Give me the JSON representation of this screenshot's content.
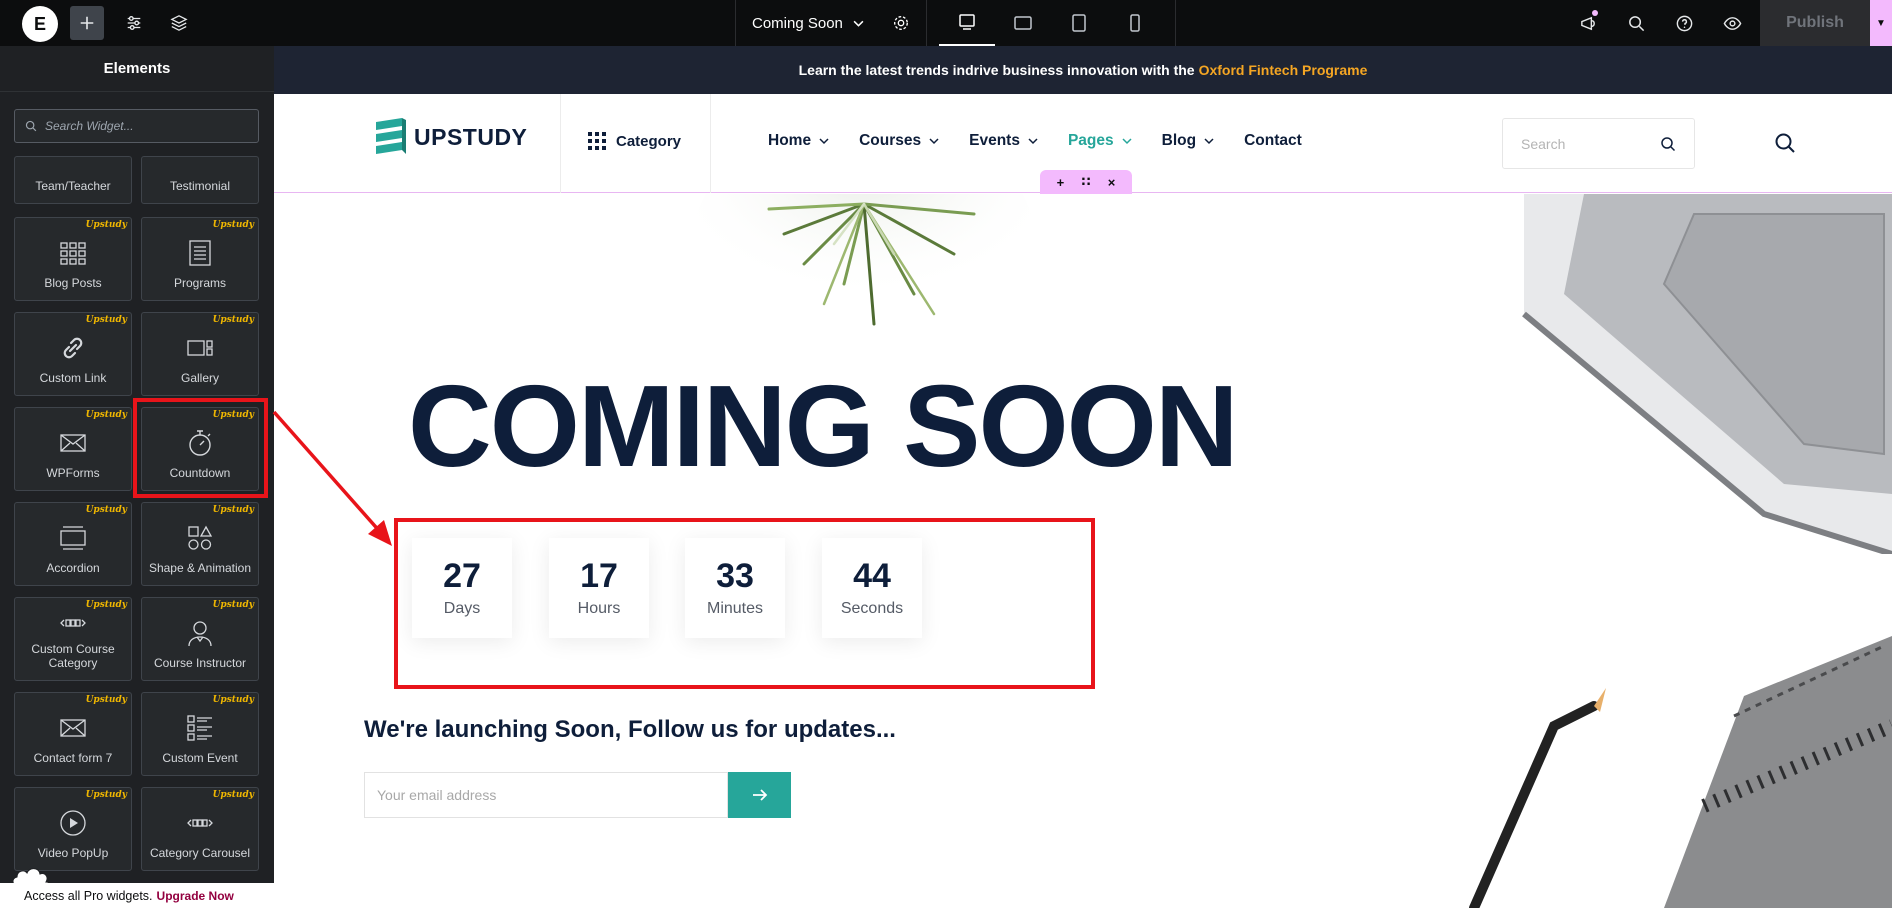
{
  "topbar": {
    "page_name": "Coming Soon",
    "publish_label": "Publish",
    "accent_color": "#f3bafd"
  },
  "panel": {
    "title": "Elements",
    "search_placeholder": "Search Widget...",
    "badge": "Upstudy",
    "widgets": [
      {
        "label": "Team/Teacher",
        "icon": "team-icon"
      },
      {
        "label": "Testimonial",
        "icon": "testimonial-icon"
      },
      {
        "label": "Blog Posts",
        "icon": "blog-posts-icon"
      },
      {
        "label": "Programs",
        "icon": "programs-icon"
      },
      {
        "label": "Custom Link",
        "icon": "link-icon"
      },
      {
        "label": "Gallery",
        "icon": "gallery-icon"
      },
      {
        "label": "WPForms",
        "icon": "envelope-icon"
      },
      {
        "label": "Countdown",
        "icon": "stopwatch-icon"
      },
      {
        "label": "Accordion",
        "icon": "accordion-icon"
      },
      {
        "label": "Shape & Animation",
        "icon": "shapes-icon"
      },
      {
        "label": "Custom Course Category",
        "icon": "course-category-icon"
      },
      {
        "label": "Course Instructor",
        "icon": "instructor-icon"
      },
      {
        "label": "Contact form 7",
        "icon": "envelope-icon"
      },
      {
        "label": "Custom Event",
        "icon": "event-list-icon"
      },
      {
        "label": "Video PopUp",
        "icon": "play-icon"
      },
      {
        "label": "Category Carousel",
        "icon": "carousel-icon"
      }
    ],
    "footer_text": "Access all Pro widgets.",
    "footer_link": "Upgrade Now"
  },
  "site": {
    "announcement_prefix": "Learn the latest trends indrive business innovation with the",
    "announcement_highlight": "Oxford Fintech Programe",
    "logo_text": "UPSTUDY",
    "category_label": "Category",
    "nav": [
      {
        "label": "Home",
        "dropdown": true,
        "active": false
      },
      {
        "label": "Courses",
        "dropdown": true,
        "active": false
      },
      {
        "label": "Events",
        "dropdown": true,
        "active": false
      },
      {
        "label": "Pages",
        "dropdown": true,
        "active": true
      },
      {
        "label": "Blog",
        "dropdown": true,
        "active": false
      },
      {
        "label": "Contact",
        "dropdown": false,
        "active": false
      }
    ],
    "search_placeholder": "Search",
    "brand_color": "#26a69a",
    "navy_color": "#0e1e3a"
  },
  "hero": {
    "title": "COMING SOON",
    "countdown": [
      {
        "value": "27",
        "label": "Days"
      },
      {
        "value": "17",
        "label": "Hours"
      },
      {
        "value": "33",
        "label": "Minutes"
      },
      {
        "value": "44",
        "label": "Seconds"
      }
    ],
    "tagline": "We're launching Soon, Follow us for updates...",
    "email_placeholder": "Your email address"
  },
  "annotation_color": "#e8141a"
}
